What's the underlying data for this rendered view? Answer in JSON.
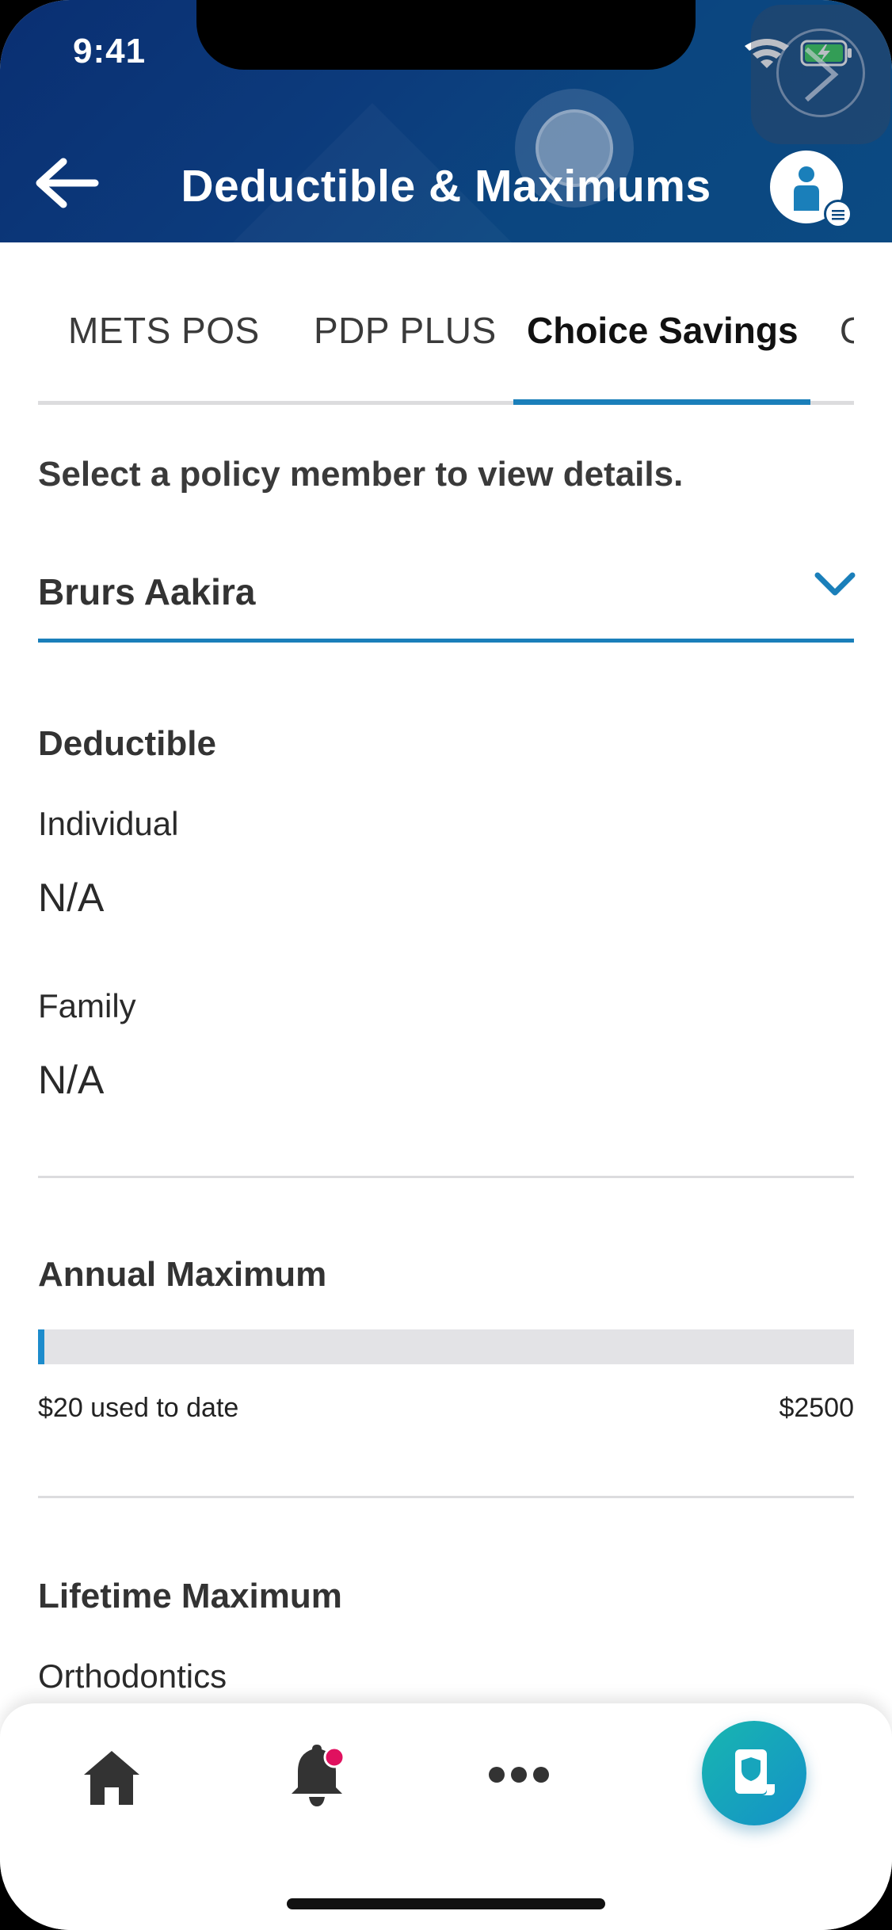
{
  "status_bar": {
    "time": "9:41"
  },
  "header": {
    "title": "Deductible & Maximums"
  },
  "tabs": [
    {
      "label": "METS POS",
      "active": false
    },
    {
      "label": "PDP PLUS",
      "active": false
    },
    {
      "label": "Choice Savings",
      "active": true
    },
    {
      "label": "Ou",
      "active": false
    }
  ],
  "member_select": {
    "prompt": "Select a policy member to view details.",
    "selected": "Brurs Aakira"
  },
  "deductible": {
    "title": "Deductible",
    "individual_label": "Individual",
    "individual_value": "N/A",
    "family_label": "Family",
    "family_value": "N/A"
  },
  "annual_maximum": {
    "title": "Annual Maximum",
    "used_text": "$20 used to date",
    "max_text": "$2500",
    "used_fraction": 0.008
  },
  "lifetime_maximum": {
    "title": "Lifetime Maximum",
    "item_label": "Orthodontics"
  },
  "bottom_nav": {
    "items": [
      "home-icon",
      "bell-icon",
      "more-icon",
      "id-card-icon"
    ],
    "notification_dot": true
  },
  "colors": {
    "header": "#0b3f7d",
    "accent": "#1a7fba",
    "fab": "#17a5bc",
    "notification": "#e0115f"
  }
}
